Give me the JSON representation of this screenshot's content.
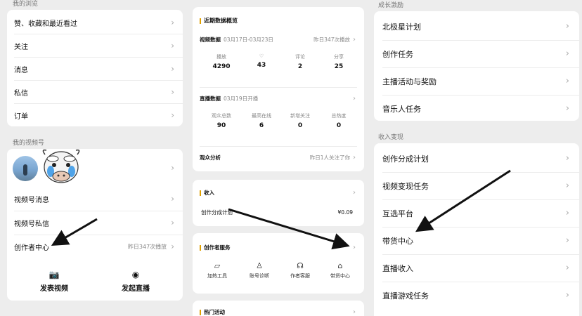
{
  "left": {
    "browse_label": "我的浏览",
    "browse_items": [
      "赞、收藏和最近看过",
      "关注",
      "消息",
      "私信",
      "订单"
    ],
    "channel_label": "我的视频号",
    "channel_items": [
      "视频号消息",
      "视频号私信"
    ],
    "creator_center": "创作者中心",
    "creator_meta": "昨日347次播放",
    "btn_video": "发表视频",
    "btn_live": "发起直播"
  },
  "mid": {
    "recent_title": "近期数据概览",
    "video_data": "视频数据",
    "video_range": "03月17日-03月23日",
    "video_meta": "昨日347次播放",
    "video_stats": [
      {
        "k": "播放",
        "v": "4290"
      },
      {
        "k": "♡",
        "v": "43"
      },
      {
        "k": "评论",
        "v": "2"
      },
      {
        "k": "分享",
        "v": "25"
      }
    ],
    "live_data": "直播数据",
    "live_date": "03月19日开播",
    "live_stats": [
      {
        "k": "观众总数",
        "v": "90"
      },
      {
        "k": "最高在线",
        "v": "6"
      },
      {
        "k": "新增关注",
        "v": "0"
      },
      {
        "k": "总热度",
        "v": "0"
      }
    ],
    "audience": "观众分析",
    "audience_meta": "昨日1人关注了你",
    "income_title": "收入",
    "income_item": "创作分成计划",
    "income_value": "¥0.09",
    "service_title": "创作者服务",
    "tools": [
      "加热工具",
      "账号诊断",
      "作者客服",
      "带货中心"
    ],
    "hot_title": "热门活动"
  },
  "right": {
    "growth_label": "成长激励",
    "growth_items": [
      "北极星计划",
      "创作任务",
      "主播活动与奖励",
      "音乐人任务"
    ],
    "monetize_label": "收入变现",
    "monetize_items": [
      "创作分成计划",
      "视频变现任务",
      "互选平台",
      "带货中心",
      "直播收入",
      "直播游戏任务"
    ]
  },
  "colors": {
    "accent": "#e0a000",
    "arrow": "#111111"
  }
}
